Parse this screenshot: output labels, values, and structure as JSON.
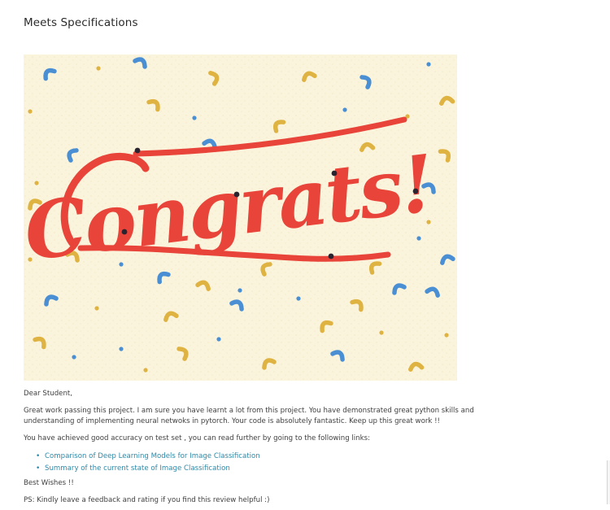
{
  "review": {
    "heading": "Meets Specifications",
    "banner": {
      "text": "Congrats!",
      "colors": {
        "background": "#fbf4dc",
        "lettering": "#e8443a",
        "blue": "#4a8fd4",
        "gold": "#dfb342",
        "dark": "#2a2430"
      }
    },
    "greeting": "Dear Student,",
    "paragraph1": "Great work passing this project. I am sure you have learnt a lot from this project. You have demonstrated great python skills and understanding of implementing neural netwoks in pytorch. Your code is absolutely fantastic. Keep up this great work !!",
    "paragraph2": "You have achieved good accuracy on test set , you can read further by going to the following links:",
    "links": [
      {
        "label": "Comparison of Deep Learning Models for Image Classification"
      },
      {
        "label": "Summary of the current state of Image Classification"
      }
    ],
    "bullet_glyph": "•",
    "signoff": "Best Wishes !!",
    "ps": "PS: Kindly leave a feedback and rating if you find this review helpful :)"
  }
}
